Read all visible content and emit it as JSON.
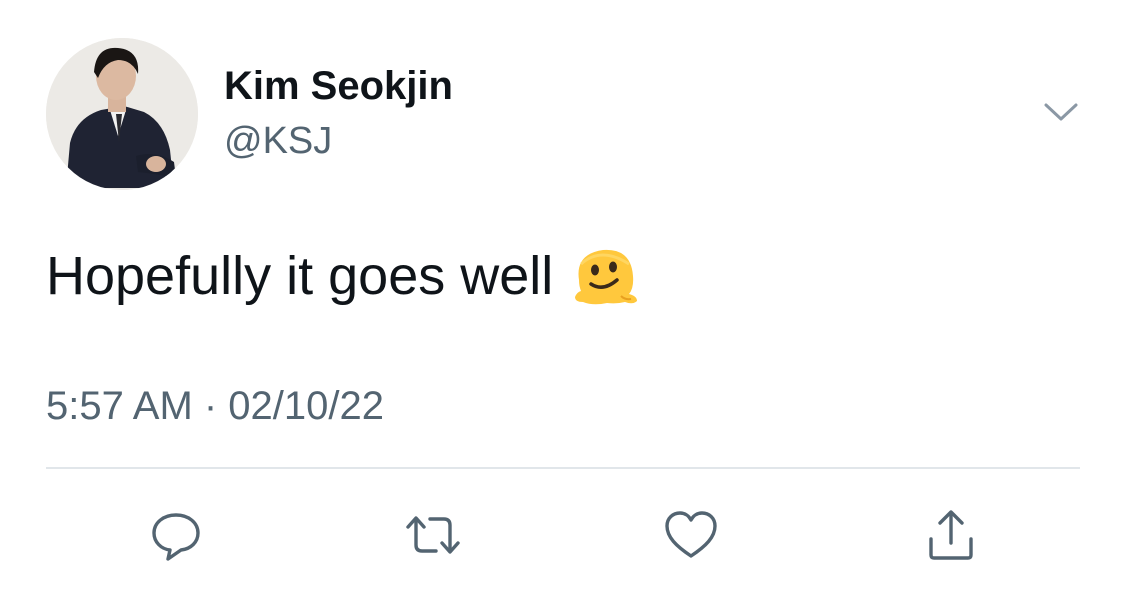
{
  "tweet": {
    "author": {
      "display_name": "Kim Seokjin",
      "handle": "@KSJ"
    },
    "text": "Hopefully it goes well",
    "emoji": "melting-face",
    "timestamp": "5:57 AM · 02/10/22"
  },
  "icons": {
    "more": "chevron-down-icon",
    "reply": "reply-icon",
    "retweet": "retweet-icon",
    "like": "heart-icon",
    "share": "share-icon"
  },
  "colors": {
    "text_primary": "#0f1419",
    "text_secondary": "#536471",
    "icon_gray": "#536471",
    "divider": "#e1e6ea",
    "background": "#ffffff"
  }
}
